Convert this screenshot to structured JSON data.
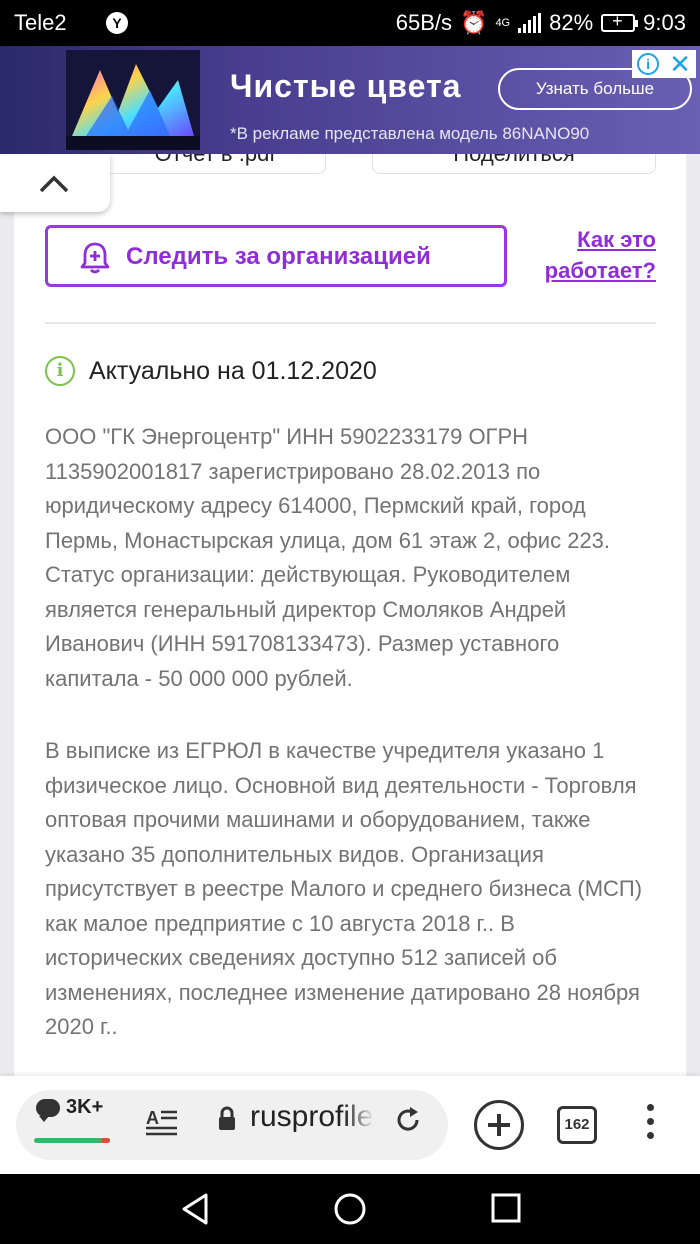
{
  "status_bar": {
    "carrier": "Tele2",
    "speed": "65B/s",
    "network": "4G",
    "battery": "82%",
    "time": "9:03"
  },
  "ad": {
    "title": "Чистые цвета",
    "cta": "Узнать больше",
    "disclaimer": "*В рекламе представлена модель 86NANO90"
  },
  "top_buttons": {
    "report": "Отчет в .pdf",
    "share": "Поделиться"
  },
  "follow_button": "Следить за организацией",
  "how_it_works_link": "Как это работает?",
  "actual": "Актуально на 01.12.2020",
  "paragraphs": [
    "ООО \"ГК Энергоцентр\" ИНН 5902233179 ОГРН 1135902001817 зарегистрировано 28.02.2013 по юридическому адресу 614000, Пермский край, город Пермь, Монастырская улица, дом 61 этаж 2, офис 223. Статус организации: действующая. Руководителем является генеральный директор Смоляков Андрей Иванович (ИНН 591708133473). Размер уставного капитала - 50 000 000 рублей.",
    "В выписке из ЕГРЮЛ в качестве учредителя указано 1 физическое лицо. Основной вид деятельности - Торговля оптовая прочими машинами и оборудованием, также указано 35 дополнительных видов. Организация присутствует в реестре Малого и среднего бизнеса (МСП) как малое предприятие с 10 августа 2018 г.. В исторических сведениях доступно 512 записей об изменениях, последнее изменение датировано 28 ноября 2020 г.."
  ],
  "browser": {
    "comments_count": "3K+",
    "url": "rusprofile.ru",
    "tabs_count": "162"
  },
  "colors": {
    "accent": "#8f2ed8",
    "info_green": "#7bc24a",
    "body_text": "#737373"
  }
}
